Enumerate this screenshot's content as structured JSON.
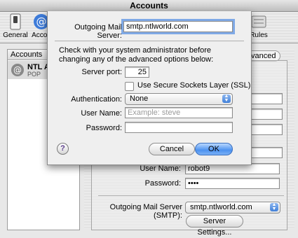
{
  "window": {
    "title": "Accounts"
  },
  "toolbar": {
    "items": [
      {
        "label": "General",
        "icon": "switch-icon"
      },
      {
        "label": "Accou",
        "icon": "at-sign-icon"
      },
      {
        "label": "Rules",
        "icon": "rules-icon"
      }
    ]
  },
  "accounts": {
    "header": "Accounts",
    "items": [
      {
        "name": "NTL Ac",
        "type": "POP"
      }
    ]
  },
  "main": {
    "advanced_tab": "Advanced",
    "user_name_label": "User Name:",
    "user_name_value": "robot9",
    "password_label": "Password:",
    "password_value": "••••",
    "smtp_label": "Outgoing Mail Server (SMTP):",
    "smtp_value": "smtp.ntlworld.com",
    "server_settings_button": "Server Settings..."
  },
  "sheet": {
    "outgoing_label": "Outgoing Mail Server:",
    "outgoing_value": "smtp.ntlworld.com",
    "note": "Check with your system administrator before changing any of the advanced options below:",
    "port_label": "Server port:",
    "port_value": "25",
    "ssl_label": "Use Secure Sockets Layer (SSL)",
    "ssl_checked": false,
    "auth_label": "Authentication:",
    "auth_value": "None",
    "username_label": "User Name:",
    "username_placeholder": "Example: steve",
    "password_label": "Password:",
    "password_value": "",
    "help_label": "?",
    "cancel_button": "Cancel",
    "ok_button": "OK"
  },
  "colors": {
    "accent": "#4c92f0",
    "focus_ring": "#7fa9e6"
  }
}
